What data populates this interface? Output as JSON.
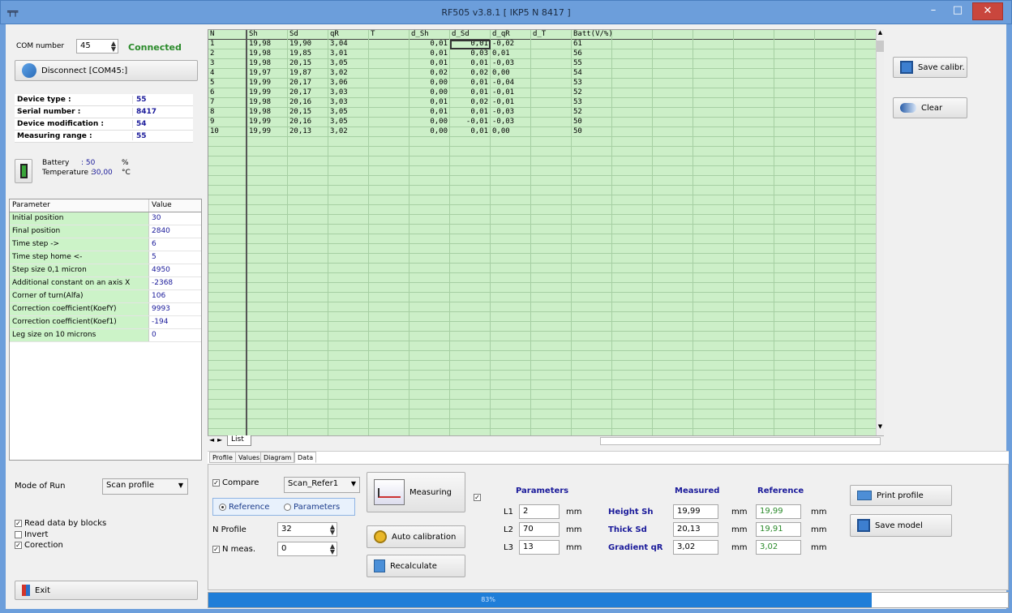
{
  "window": {
    "title": "RF505 v3.8.1 [ IKP5 N 8417 ]",
    "minimize": "–",
    "maximize": "□",
    "close": "✕"
  },
  "connection": {
    "com_label": "COM number",
    "com_value": "45",
    "status": "Connected",
    "disconnect_label": "Disconnect [COM45:]"
  },
  "device": {
    "rows": [
      {
        "key": "Device type :",
        "value": "55"
      },
      {
        "key": "Serial number :",
        "value": "8417"
      },
      {
        "key": "Device modification :",
        "value": "54"
      },
      {
        "key": "Measuring range :",
        "value": "55"
      }
    ]
  },
  "battery": {
    "battery_label": "Battery",
    "battery_value": ": 50",
    "battery_unit": "%",
    "temp_label": "Temperature :",
    "temp_value": "30,00",
    "temp_unit": "°C"
  },
  "params": {
    "col1": "Parameter",
    "col2": "Value",
    "rows": [
      {
        "name": "Initial position",
        "value": "30"
      },
      {
        "name": "Final position",
        "value": "2840"
      },
      {
        "name": "Time  step ->",
        "value": "6"
      },
      {
        "name": "Time step home <-",
        "value": "5"
      },
      {
        "name": "Step size 0,1 micron",
        "value": "4950"
      },
      {
        "name": "Additional constant on an axis X",
        "value": "-2368"
      },
      {
        "name": "Corner of turn(Alfa)",
        "value": "106"
      },
      {
        "name": "Correction coefficient(KoefY)",
        "value": "9993"
      },
      {
        "name": "Correction coefficient(Koef1)",
        "value": "-194"
      },
      {
        "name": "Leg size on 10 microns",
        "value": "0"
      }
    ]
  },
  "run": {
    "mode_label": "Mode of Run",
    "mode_value": "Scan profile",
    "read_blocks": "Read data by blocks",
    "invert": "Invert",
    "correction": "Corection",
    "exit": "Exit"
  },
  "grid": {
    "headers": [
      "N",
      "Sh",
      "Sd",
      "qR",
      "T",
      "d_Sh",
      "d_Sd",
      "d_qR",
      "d_T",
      "Batt(V/%)",
      "",
      "",
      "",
      "",
      "",
      ""
    ],
    "rows": [
      [
        "1",
        "19,98",
        "19,90",
        "3,04",
        "",
        "0,01",
        "0,01",
        "-0,02",
        "",
        "61"
      ],
      [
        "2",
        "19,98",
        "19,85",
        "3,01",
        "",
        "0,01",
        "0,03",
        "0,01",
        "",
        "56"
      ],
      [
        "3",
        "19,98",
        "20,15",
        "3,05",
        "",
        "0,01",
        "0,01",
        "-0,03",
        "",
        "55"
      ],
      [
        "4",
        "19,97",
        "19,87",
        "3,02",
        "",
        "0,02",
        "0,02",
        "0,00",
        "",
        "54"
      ],
      [
        "5",
        "19,99",
        "20,17",
        "3,06",
        "",
        "0,00",
        "0,01",
        "-0,04",
        "",
        "53"
      ],
      [
        "6",
        "19,99",
        "20,17",
        "3,03",
        "",
        "0,00",
        "0,01",
        "-0,01",
        "",
        "52"
      ],
      [
        "7",
        "19,98",
        "20,16",
        "3,03",
        "",
        "0,01",
        "0,02",
        "-0,01",
        "",
        "53"
      ],
      [
        "8",
        "19,98",
        "20,15",
        "3,05",
        "",
        "0,01",
        "0,01",
        "-0,03",
        "",
        "52"
      ],
      [
        "9",
        "19,99",
        "20,16",
        "3,05",
        "",
        "0,00",
        "-0,01",
        "-0,03",
        "",
        "50"
      ],
      [
        "10",
        "19,99",
        "20,13",
        "3,02",
        "",
        "0,00",
        "0,01",
        "0,00",
        "",
        "50"
      ]
    ],
    "sheet_tab": "List"
  },
  "tabs": [
    "Profile",
    "Values",
    "Diagram",
    "Data"
  ],
  "right": {
    "save_calibr": "Save calibr.",
    "clear": "Clear"
  },
  "controls": {
    "compare": "Compare",
    "compare_value": "Scan_Refer1",
    "reference": "Reference",
    "parameters": "Parameters",
    "n_profile_label": "N Profile",
    "n_profile_value": "32",
    "n_meas_label": "N meas.",
    "n_meas_value": "0",
    "measuring": "Measuring",
    "auto_calibration": "Auto calibration",
    "recalculate": "Recalculate"
  },
  "params_panel": {
    "title": "Parameters",
    "rows": [
      {
        "label": "L1",
        "value": "2",
        "unit": "mm"
      },
      {
        "label": "L2",
        "value": "70",
        "unit": "mm"
      },
      {
        "label": "L3",
        "value": "13",
        "unit": "mm"
      }
    ]
  },
  "measured_panel": {
    "measured_title": "Measured",
    "reference_title": "Reference",
    "rows": [
      {
        "label": "Height  Sh",
        "measured": "19,99",
        "unit1": "mm",
        "reference": "19,99",
        "unit2": "mm"
      },
      {
        "label": "Thick   Sd",
        "measured": "20,13",
        "unit1": "mm",
        "reference": "19,91",
        "unit2": "mm"
      },
      {
        "label": "Gradient qR",
        "measured": "3,02",
        "unit1": "mm",
        "reference": "3,02",
        "unit2": "mm"
      }
    ]
  },
  "print_profile": "Print profile",
  "save_model": "Save model",
  "progress": {
    "value": 0.83,
    "text": "83%"
  }
}
